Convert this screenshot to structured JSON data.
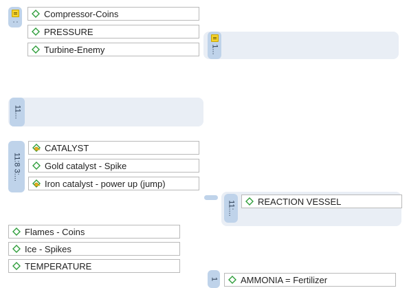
{
  "groups": {
    "top": {
      "tab_text": ":",
      "items": [
        {
          "label": "Compressor-Coins",
          "icon": "diamond-icon"
        },
        {
          "label": "PRESSURE",
          "icon": "diamond-icon"
        },
        {
          "label": "Turbine-Enemy",
          "icon": "diamond-icon"
        }
      ]
    },
    "right_collapsed": {
      "tab_text": "1..."
    },
    "middle_collapsed": {
      "tab_text": "11..."
    },
    "catalyst": {
      "tab_text": "11:8 3:...",
      "items": [
        {
          "label": "CATALYST",
          "icon": "diamond-key-icon"
        },
        {
          "label": "Gold catalyst - Spike",
          "icon": "diamond-icon"
        },
        {
          "label": "Iron catalyst - power up (jump)",
          "icon": "diamond-key-icon"
        }
      ]
    },
    "reaction": {
      "tab_text": "11:...",
      "items": [
        {
          "label": "REACTION VESSEL",
          "icon": "diamond-icon"
        }
      ]
    },
    "temperature": {
      "items": [
        {
          "label": "Flames - Coins",
          "icon": "diamond-icon"
        },
        {
          "label": "Ice - Spikes",
          "icon": "diamond-icon"
        },
        {
          "label": "TEMPERATURE",
          "icon": "diamond-icon"
        }
      ]
    },
    "ammonia": {
      "tab_text": "1",
      "items": [
        {
          "label": "AMMONIA = Fertilizer",
          "icon": "diamond-icon"
        }
      ]
    }
  },
  "colors": {
    "group_background": "#e9eef5",
    "tab_background": "#bfd3ea",
    "item_border": "#b9b9b9",
    "diamond_icon": "#2e9d3a",
    "key_icon": "#e2b11c",
    "flag_icon": "#f4d22d"
  }
}
